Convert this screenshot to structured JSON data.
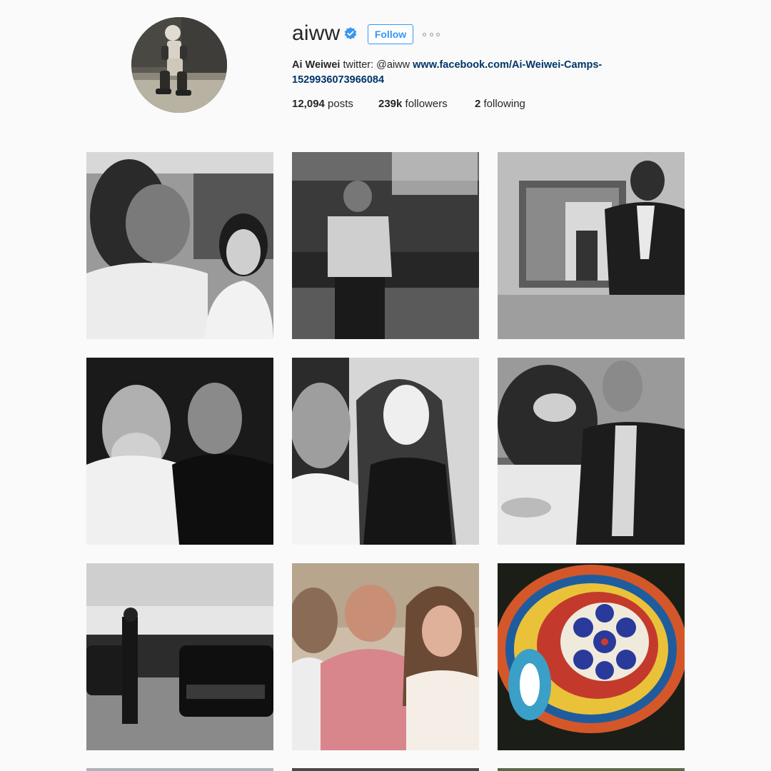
{
  "profile": {
    "username": "aiww",
    "follow_label": "Follow",
    "bio_name": "Ai Weiwei",
    "bio_text": " twitter: @aiww ",
    "bio_link": "www.facebook.com/Ai-Weiwei-Camps-1529936073966084",
    "posts_count": "12,094",
    "posts_label": " posts",
    "followers_count": "239k",
    "followers_label": " followers",
    "following_count": "2",
    "following_label": " following"
  },
  "icons": {
    "verified": "verified-badge-icon",
    "more": "more-options-icon"
  },
  "colors": {
    "accent": "#3897f0",
    "link": "#003569",
    "background": "#fafafa"
  }
}
